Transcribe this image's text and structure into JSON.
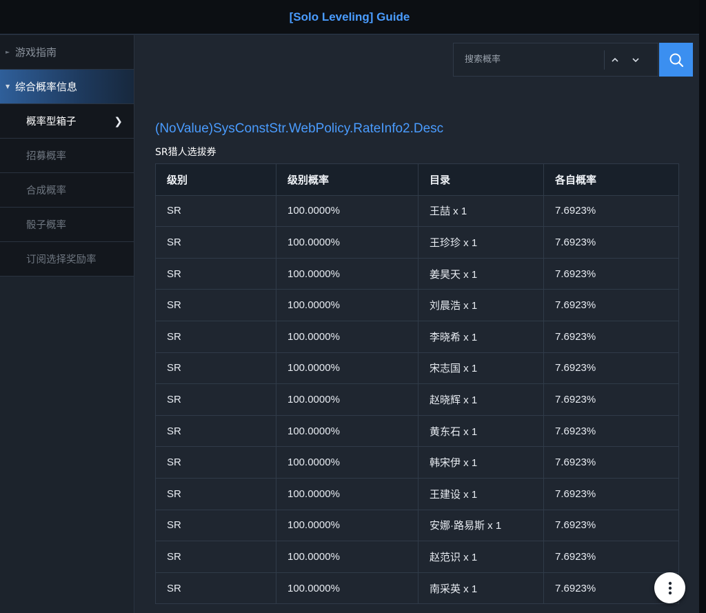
{
  "header": {
    "title": "[Solo Leveling] Guide"
  },
  "sidebar": {
    "groups": [
      {
        "label": "游戏指南",
        "expanded": false
      },
      {
        "label": "综合概率信息",
        "expanded": true
      }
    ],
    "sub_items": [
      {
        "label": "概率型箱子",
        "active": true
      },
      {
        "label": "招募概率",
        "active": false
      },
      {
        "label": "合成概率",
        "active": false
      },
      {
        "label": "骰子概率",
        "active": false
      },
      {
        "label": "订阅选择奖励率",
        "active": false
      }
    ]
  },
  "search": {
    "placeholder": "搜索概率",
    "value": ""
  },
  "content": {
    "title": "(NoValue)SysConstStr.WebPolicy.RateInfo2.Desc",
    "subtitle": "SR猎人选拔券",
    "table": {
      "headers": [
        "级别",
        "级别概率",
        "目录",
        "各自概率"
      ],
      "rows": [
        [
          "SR",
          "100.0000%",
          "王喆 x 1",
          "7.6923%"
        ],
        [
          "SR",
          "100.0000%",
          "王珍珍 x 1",
          "7.6923%"
        ],
        [
          "SR",
          "100.0000%",
          "姜昊天 x 1",
          "7.6923%"
        ],
        [
          "SR",
          "100.0000%",
          "刘晨浩 x 1",
          "7.6923%"
        ],
        [
          "SR",
          "100.0000%",
          "李晓希 x 1",
          "7.6923%"
        ],
        [
          "SR",
          "100.0000%",
          "宋志国 x 1",
          "7.6923%"
        ],
        [
          "SR",
          "100.0000%",
          "赵晓辉 x 1",
          "7.6923%"
        ],
        [
          "SR",
          "100.0000%",
          "黄东石 x 1",
          "7.6923%"
        ],
        [
          "SR",
          "100.0000%",
          "韩宋伊 x 1",
          "7.6923%"
        ],
        [
          "SR",
          "100.0000%",
          "王建设 x 1",
          "7.6923%"
        ],
        [
          "SR",
          "100.0000%",
          "安娜·路易斯 x 1",
          "7.6923%"
        ],
        [
          "SR",
          "100.0000%",
          "赵范识 x 1",
          "7.6923%"
        ],
        [
          "SR",
          "100.0000%",
          "南采英 x 1",
          "7.6923%"
        ]
      ]
    }
  },
  "colors": {
    "accent": "#4a9cff",
    "search_button": "#3b8ff0",
    "background": "#1f2630"
  },
  "icons": {
    "search": "search-icon",
    "up": "chevron-up-icon",
    "down": "chevron-down-icon",
    "more": "more-vertical-icon",
    "expand": "chevron-right-icon"
  }
}
